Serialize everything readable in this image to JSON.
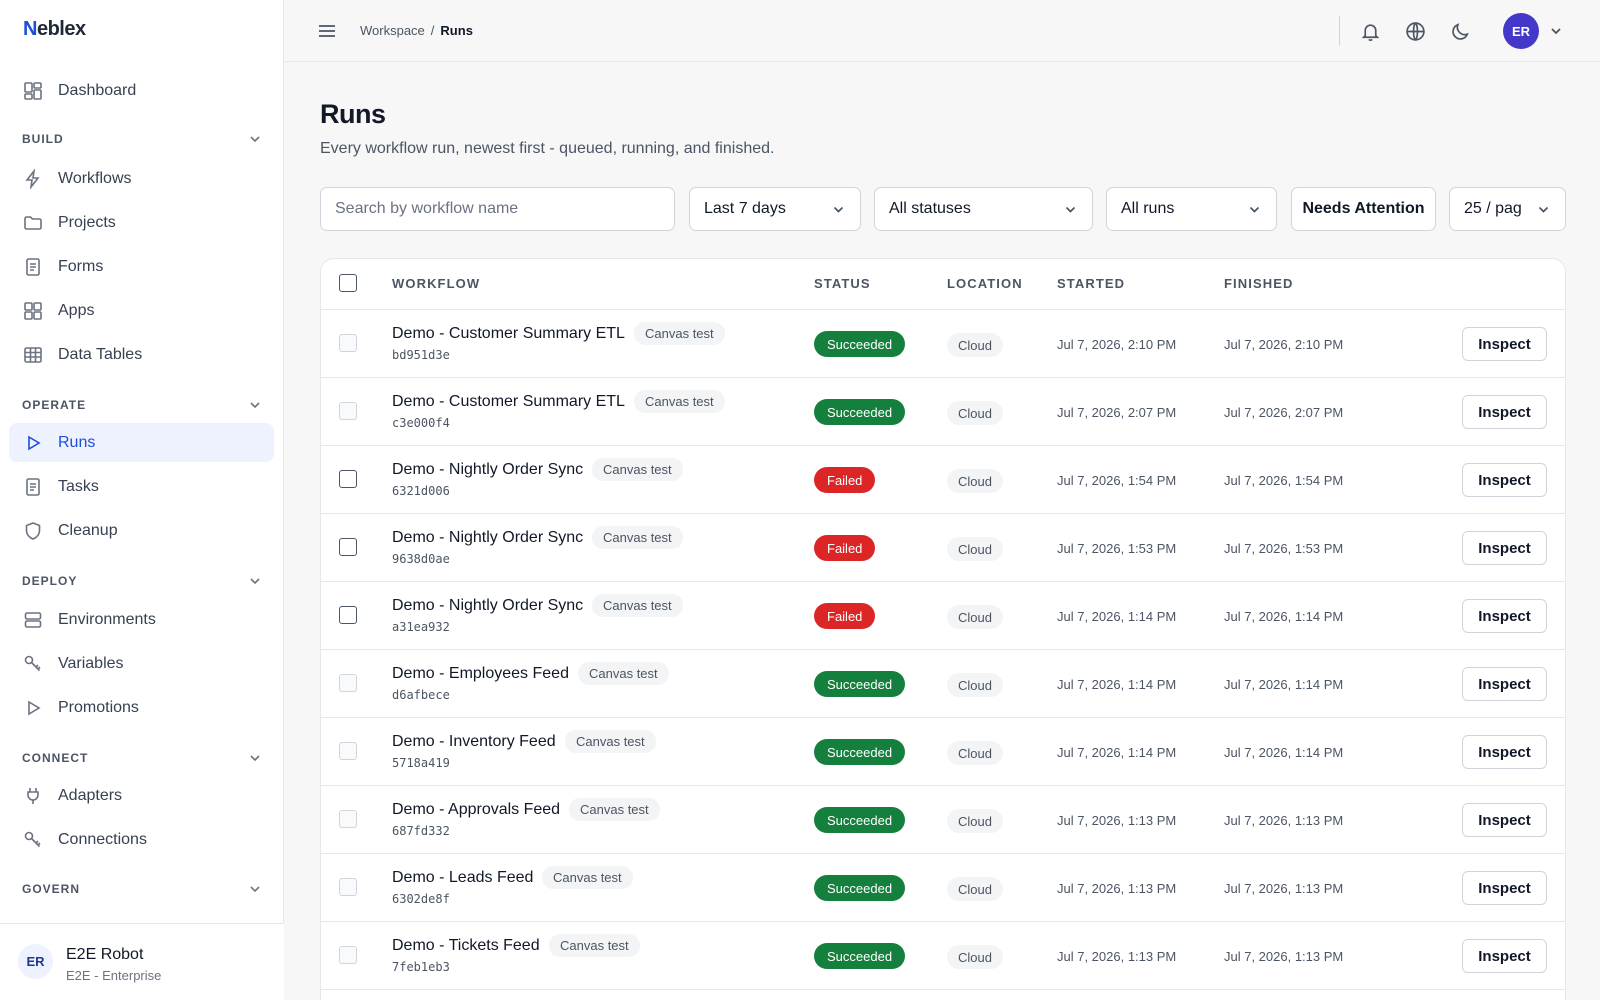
{
  "app": {
    "brand": "Neblex"
  },
  "sidebar": {
    "items": {
      "dashboard": "Dashboard",
      "workflows": "Workflows",
      "projects": "Projects",
      "forms": "Forms",
      "apps": "Apps",
      "data_tables": "Data Tables",
      "runs": "Runs",
      "tasks": "Tasks",
      "cleanup": "Cleanup",
      "environments": "Environments",
      "variables": "Variables",
      "promotions": "Promotions",
      "adapters": "Adapters",
      "connections": "Connections"
    },
    "sections": {
      "build": "BUILD",
      "operate": "OPERATE",
      "deploy": "DEPLOY",
      "connect": "CONNECT",
      "govern": "GOVERN"
    },
    "active_item": "Runs",
    "user": {
      "initials": "ER",
      "name": "E2E Robot",
      "role": "E2E - Enterprise"
    }
  },
  "topbar": {
    "breadcrumb": [
      "Workspace",
      "/",
      "Runs"
    ],
    "avatar_initials": "ER"
  },
  "page": {
    "title": "Runs",
    "subtitle": "Every workflow run, newest first - queued, running, and finished."
  },
  "filters": {
    "search_placeholder": "Search by workflow name",
    "range": "Last 7 days",
    "status": "All statuses",
    "runs": "All runs",
    "attention_label": "Needs Attention",
    "page_size": "25 / pag"
  },
  "table": {
    "columns": [
      "WORKFLOW",
      "STATUS",
      "LOCATION",
      "STARTED",
      "FINISHED"
    ],
    "action_label": "Inspect",
    "rows": [
      {
        "workflow": "Demo - Customer Summary ETL",
        "tag": "Canvas test",
        "id": "bd951d3e",
        "status": "Succeeded",
        "location": "Cloud",
        "started": "Jul 7, 2026, 2:10 PM",
        "finished": "Jul 7, 2026, 2:10 PM"
      },
      {
        "workflow": "Demo - Customer Summary ETL",
        "tag": "Canvas test",
        "id": "c3e000f4",
        "status": "Succeeded",
        "location": "Cloud",
        "started": "Jul 7, 2026, 2:07 PM",
        "finished": "Jul 7, 2026, 2:07 PM"
      },
      {
        "workflow": "Demo - Nightly Order Sync",
        "tag": "Canvas test",
        "id": "6321d006",
        "status": "Failed",
        "location": "Cloud",
        "started": "Jul 7, 2026, 1:54 PM",
        "finished": "Jul 7, 2026, 1:54 PM"
      },
      {
        "workflow": "Demo - Nightly Order Sync",
        "tag": "Canvas test",
        "id": "9638d0ae",
        "status": "Failed",
        "location": "Cloud",
        "started": "Jul 7, 2026, 1:53 PM",
        "finished": "Jul 7, 2026, 1:53 PM"
      },
      {
        "workflow": "Demo - Nightly Order Sync",
        "tag": "Canvas test",
        "id": "a31ea932",
        "status": "Failed",
        "location": "Cloud",
        "started": "Jul 7, 2026, 1:14 PM",
        "finished": "Jul 7, 2026, 1:14 PM"
      },
      {
        "workflow": "Demo - Employees Feed",
        "tag": "Canvas test",
        "id": "d6afbece",
        "status": "Succeeded",
        "location": "Cloud",
        "started": "Jul 7, 2026, 1:14 PM",
        "finished": "Jul 7, 2026, 1:14 PM"
      },
      {
        "workflow": "Demo - Inventory Feed",
        "tag": "Canvas test",
        "id": "5718a419",
        "status": "Succeeded",
        "location": "Cloud",
        "started": "Jul 7, 2026, 1:14 PM",
        "finished": "Jul 7, 2026, 1:14 PM"
      },
      {
        "workflow": "Demo - Approvals Feed",
        "tag": "Canvas test",
        "id": "687fd332",
        "status": "Succeeded",
        "location": "Cloud",
        "started": "Jul 7, 2026, 1:13 PM",
        "finished": "Jul 7, 2026, 1:13 PM"
      },
      {
        "workflow": "Demo - Leads Feed",
        "tag": "Canvas test",
        "id": "6302de8f",
        "status": "Succeeded",
        "location": "Cloud",
        "started": "Jul 7, 2026, 1:13 PM",
        "finished": "Jul 7, 2026, 1:13 PM"
      },
      {
        "workflow": "Demo - Tickets Feed",
        "tag": "Canvas test",
        "id": "7feb1eb3",
        "status": "Succeeded",
        "location": "Cloud",
        "started": "Jul 7, 2026, 1:13 PM",
        "finished": "Jul 7, 2026, 1:13 PM"
      }
    ]
  },
  "colors": {
    "accent": "#1d4ed8",
    "succeeded": "#15803d",
    "failed": "#dc2626",
    "avatar": "#4338ca"
  },
  "icons": {
    "topbar": [
      "menu-icon",
      "bell-icon",
      "globe-icon",
      "moon-icon",
      "chevron-down-icon"
    ]
  }
}
